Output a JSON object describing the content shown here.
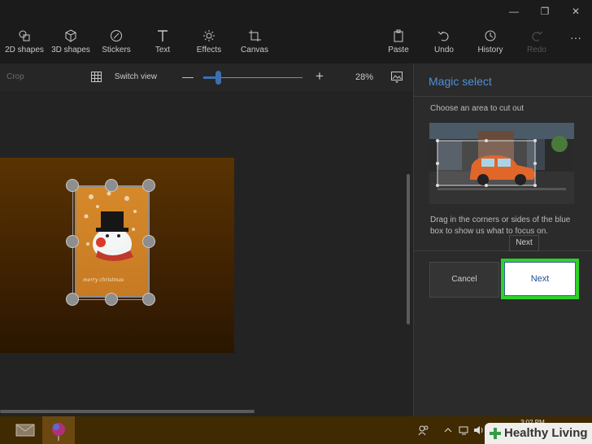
{
  "window": {
    "minimize": "—",
    "maximize": "❐",
    "close": "✕"
  },
  "toolbar": {
    "items": [
      {
        "label": "2D shapes",
        "icon": "2d-shapes-icon"
      },
      {
        "label": "3D shapes",
        "icon": "3d-shapes-icon"
      },
      {
        "label": "Stickers",
        "icon": "stickers-icon"
      },
      {
        "label": "Text",
        "icon": "text-icon"
      },
      {
        "label": "Effects",
        "icon": "effects-icon"
      },
      {
        "label": "Canvas",
        "icon": "canvas-icon"
      }
    ],
    "right_items": [
      {
        "label": "Paste",
        "icon": "paste-icon"
      },
      {
        "label": "Undo",
        "icon": "undo-icon"
      },
      {
        "label": "History",
        "icon": "history-icon"
      },
      {
        "label": "Redo",
        "icon": "redo-icon"
      }
    ],
    "more": "···"
  },
  "subbar": {
    "crop_label": "Crop",
    "switch_view_label": "Switch view",
    "zoom_minus": "—",
    "zoom_plus": "+",
    "zoom_value": "28%",
    "zoom_fraction": 0.15
  },
  "panel": {
    "title": "Magic select",
    "subtitle": "Choose an area to cut out",
    "help": "Drag in the corners or sides of the blue box to show us what to focus on.",
    "tooltip": "Next",
    "cancel_label": "Cancel",
    "next_label": "Next"
  },
  "taskbar": {
    "clock": "3:02 PM"
  },
  "watermark": {
    "text": "Healthy Living"
  },
  "colors": {
    "accent": "#4f8fd6",
    "highlight": "#2ed12a",
    "taskbar": "#3f2a02"
  }
}
